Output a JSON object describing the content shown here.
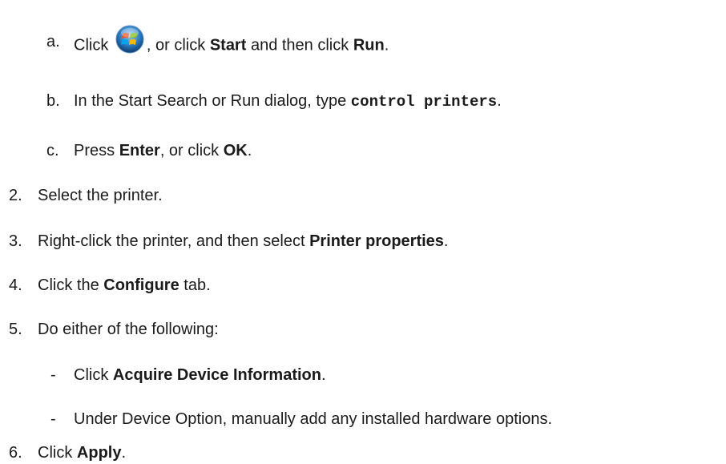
{
  "substeps": [
    {
      "marker": "a.",
      "click_word": "Click",
      "between": ", or click",
      "start_label": "Start",
      "and_then": "and then click",
      "run_label": "Run",
      "end": ".",
      "icon": "windows-start-orb-icon"
    },
    {
      "marker": "b.",
      "before": "In the Start Search or Run dialog, type",
      "command": "control printers",
      "end": "."
    },
    {
      "marker": "c.",
      "before": "Press",
      "enter_label": "Enter",
      "middle": ", or click",
      "ok_label": "OK",
      "end": "."
    }
  ],
  "steps": [
    {
      "marker": "2.",
      "text": "Select the printer."
    },
    {
      "marker": "3.",
      "before": "Right-click the printer, and then select",
      "bold": "Printer properties",
      "end": "."
    },
    {
      "marker": "4.",
      "before": "Click the",
      "bold": "Configure",
      "after": "tab."
    },
    {
      "marker": "5.",
      "text": "Do either of the following:"
    },
    {
      "marker": "6.",
      "before": "Click",
      "bold": "Apply",
      "end": "."
    }
  ],
  "options": [
    {
      "marker": "-",
      "before": "Click",
      "bold": "Acquire Device Information",
      "end": "."
    },
    {
      "marker": "-",
      "text": "Under Device Option, manually add any installed hardware options."
    }
  ]
}
